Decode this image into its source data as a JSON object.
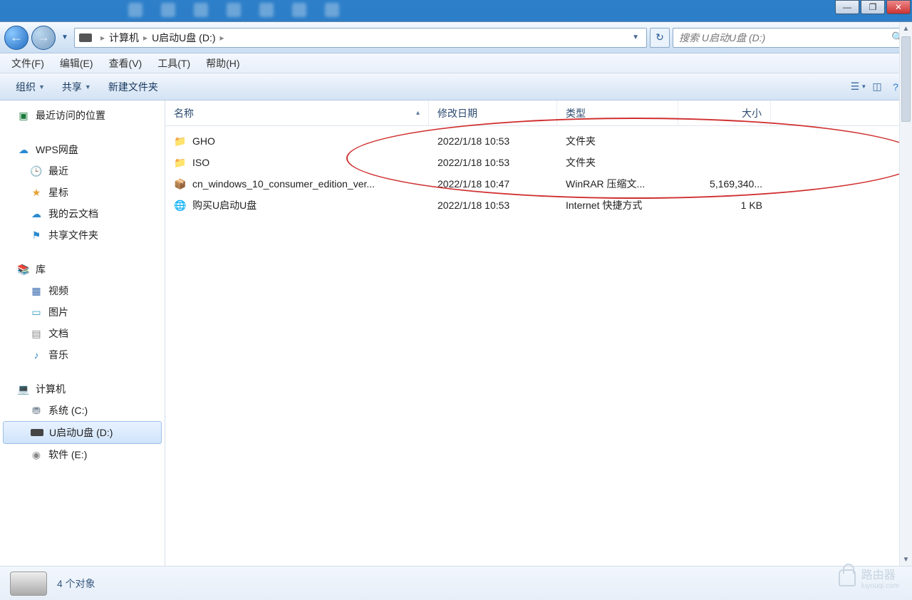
{
  "window_controls": {
    "min": "—",
    "max": "❐",
    "close": "✕"
  },
  "nav": {
    "back": "←",
    "forward": "→",
    "breadcrumb": {
      "root": "计算机",
      "drive": "U启动U盘 (D:)"
    },
    "search_placeholder": "搜索 U启动U盘 (D:)"
  },
  "menubar": [
    "文件(F)",
    "编辑(E)",
    "查看(V)",
    "工具(T)",
    "帮助(H)"
  ],
  "toolbar": {
    "organize": "组织",
    "share": "共享",
    "newfolder": "新建文件夹"
  },
  "sidebar": {
    "recent": "最近访问的位置",
    "wps": "WPS网盘",
    "wps_items": [
      "最近",
      "星标",
      "我的云文档",
      "共享文件夹"
    ],
    "libraries": "库",
    "lib_items": [
      "视频",
      "图片",
      "文档",
      "音乐"
    ],
    "computer": "计算机",
    "drives": [
      "系统 (C:)",
      "U启动U盘 (D:)",
      "软件 (E:)"
    ]
  },
  "columns": {
    "name": "名称",
    "date": "修改日期",
    "type": "类型",
    "size": "大小"
  },
  "files": [
    {
      "icon": "folder",
      "name": "GHO",
      "date": "2022/1/18 10:53",
      "type": "文件夹",
      "size": ""
    },
    {
      "icon": "folder",
      "name": "ISO",
      "date": "2022/1/18 10:53",
      "type": "文件夹",
      "size": ""
    },
    {
      "icon": "rar",
      "name": "cn_windows_10_consumer_edition_ver...",
      "date": "2022/1/18 10:47",
      "type": "WinRAR 压缩文...",
      "size": "5,169,340..."
    },
    {
      "icon": "url",
      "name": "购买U启动U盘",
      "date": "2022/1/18 10:53",
      "type": "Internet 快捷方式",
      "size": "1 KB"
    }
  ],
  "status": {
    "count": "4 个对象"
  },
  "watermark": {
    "main": "路由器",
    "sub": "luyouqi.com"
  }
}
